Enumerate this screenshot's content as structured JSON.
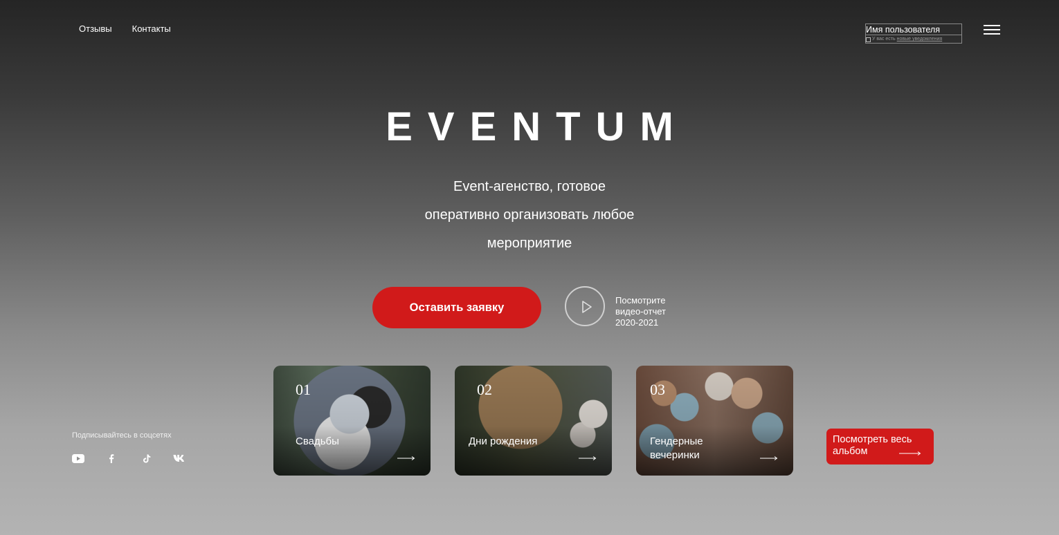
{
  "header": {
    "nav": [
      "Отзывы",
      "Контакты"
    ],
    "user": {
      "name": "Имя пользователя",
      "note_prefix": "У вас есть",
      "note_link": "новые уведомления"
    },
    "menu_icon": "hamburger-icon"
  },
  "hero": {
    "brand": "EVENTUM",
    "tagline": [
      "Event-агенство, готовое",
      "оперативно организовать любое",
      "мероприятие"
    ],
    "cta_label": "Оставить заявку",
    "video": {
      "icon": "play-icon",
      "lines": [
        "Посмотрите",
        "видео-отчет",
        "2020-2021"
      ]
    }
  },
  "cards": [
    {
      "num": "01",
      "label": "Свадьбы"
    },
    {
      "num": "02",
      "label": "Дни рождения"
    },
    {
      "num": "03",
      "label_lines": [
        "Гендерные",
        "вечеринки"
      ]
    }
  ],
  "album": {
    "lines": [
      "Посмотреть весь",
      "альбом"
    ]
  },
  "social": {
    "title": "Подписывайтесь в соцсетях",
    "icons": [
      "youtube-icon",
      "facebook-icon",
      "tiktok-icon",
      "vk-icon"
    ]
  },
  "colors": {
    "accent": "#d11a1a",
    "text": "#ffffff"
  }
}
